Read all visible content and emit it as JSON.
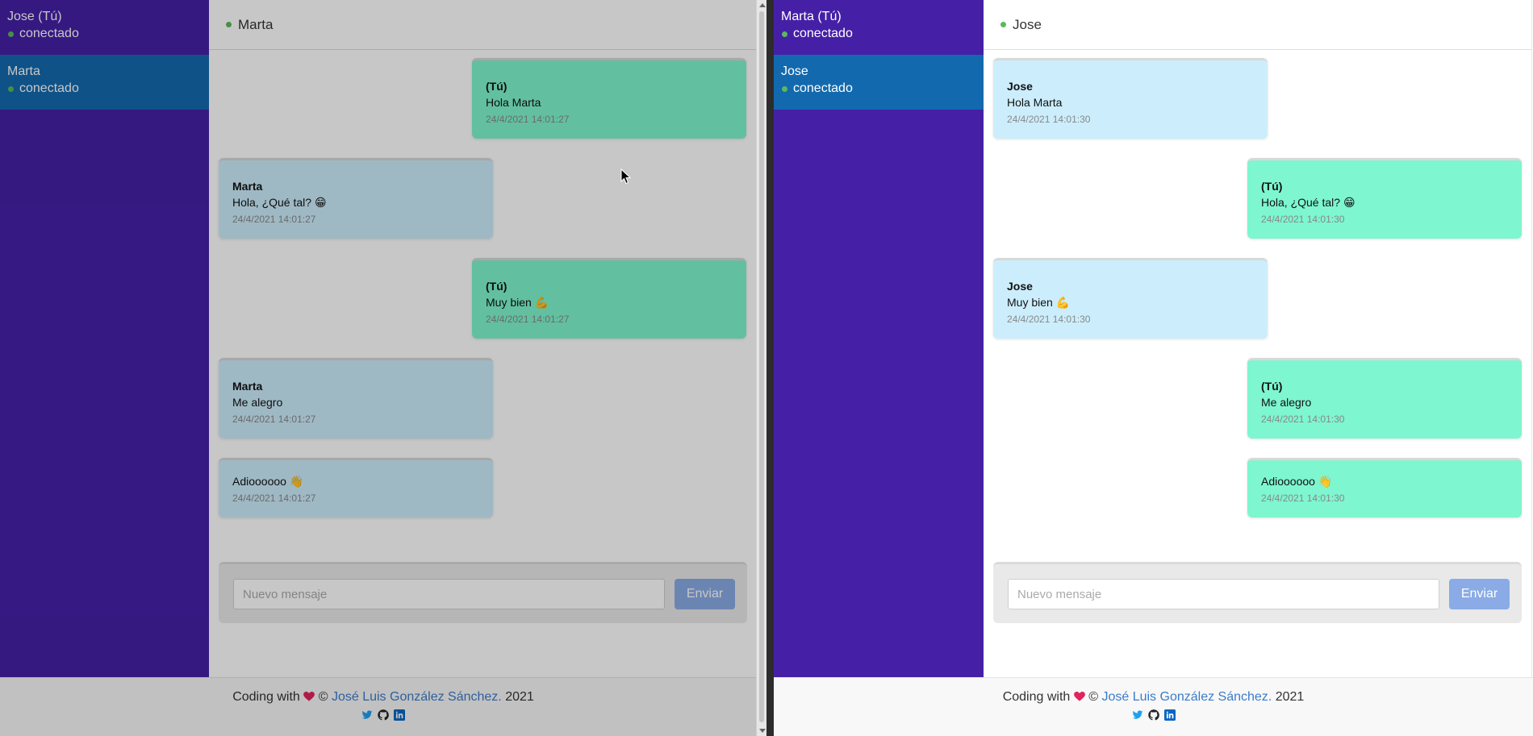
{
  "left_window": {
    "sidebar": {
      "contacts": [
        {
          "name": "Jose (Tú)",
          "status": "conectado"
        },
        {
          "name": "Marta",
          "status": "conectado"
        }
      ]
    },
    "header": {
      "name": "Marta"
    },
    "messages": [
      {
        "author": "(Tú)",
        "text": "Hola Marta",
        "time": "24/4/2021 14:01:27"
      },
      {
        "author": "Marta",
        "text": "Hola, ¿Qué tal? 😁",
        "time": "24/4/2021 14:01:27"
      },
      {
        "author": "(Tú)",
        "text": "Muy bien 💪",
        "time": "24/4/2021 14:01:27"
      },
      {
        "author": "Marta",
        "text": "Me alegro",
        "time": "24/4/2021 14:01:27"
      },
      {
        "author": "",
        "text": "Adioooooo 👋",
        "time": "24/4/2021 14:01:27"
      }
    ],
    "composer": {
      "placeholder": "Nuevo mensaje",
      "send_label": "Enviar"
    }
  },
  "right_window": {
    "sidebar": {
      "contacts": [
        {
          "name": "Marta (Tú)",
          "status": "conectado"
        },
        {
          "name": "Jose",
          "status": "conectado"
        }
      ]
    },
    "header": {
      "name": "Jose"
    },
    "messages": [
      {
        "author": "Jose",
        "text": "Hola Marta",
        "time": "24/4/2021 14:01:30"
      },
      {
        "author": "(Tú)",
        "text": "Hola, ¿Qué tal? 😁",
        "time": "24/4/2021 14:01:30"
      },
      {
        "author": "Jose",
        "text": "Muy bien 💪",
        "time": "24/4/2021 14:01:30"
      },
      {
        "author": "(Tú)",
        "text": "Me alegro",
        "time": "24/4/2021 14:01:30"
      },
      {
        "author": "",
        "text": "Adioooooo 👋",
        "time": "24/4/2021 14:01:30"
      }
    ],
    "composer": {
      "placeholder": "Nuevo mensaje",
      "send_label": "Enviar"
    }
  },
  "footer": {
    "prefix": "Coding with",
    "copyright": "©",
    "author_link": "José Luis González Sánchez.",
    "year": "2021",
    "social_icons": [
      "twitter-icon",
      "github-icon",
      "linkedin-icon"
    ]
  },
  "colors": {
    "sidebar_bg": "#4520a6",
    "active_contact_bg": "#1369ad",
    "my_message_bg": "#7ef6cf",
    "other_message_bg": "#cceefc",
    "online_dot": "#5cb85c",
    "send_button_bg": "#8aabe6",
    "link": "#3a7cc9"
  }
}
